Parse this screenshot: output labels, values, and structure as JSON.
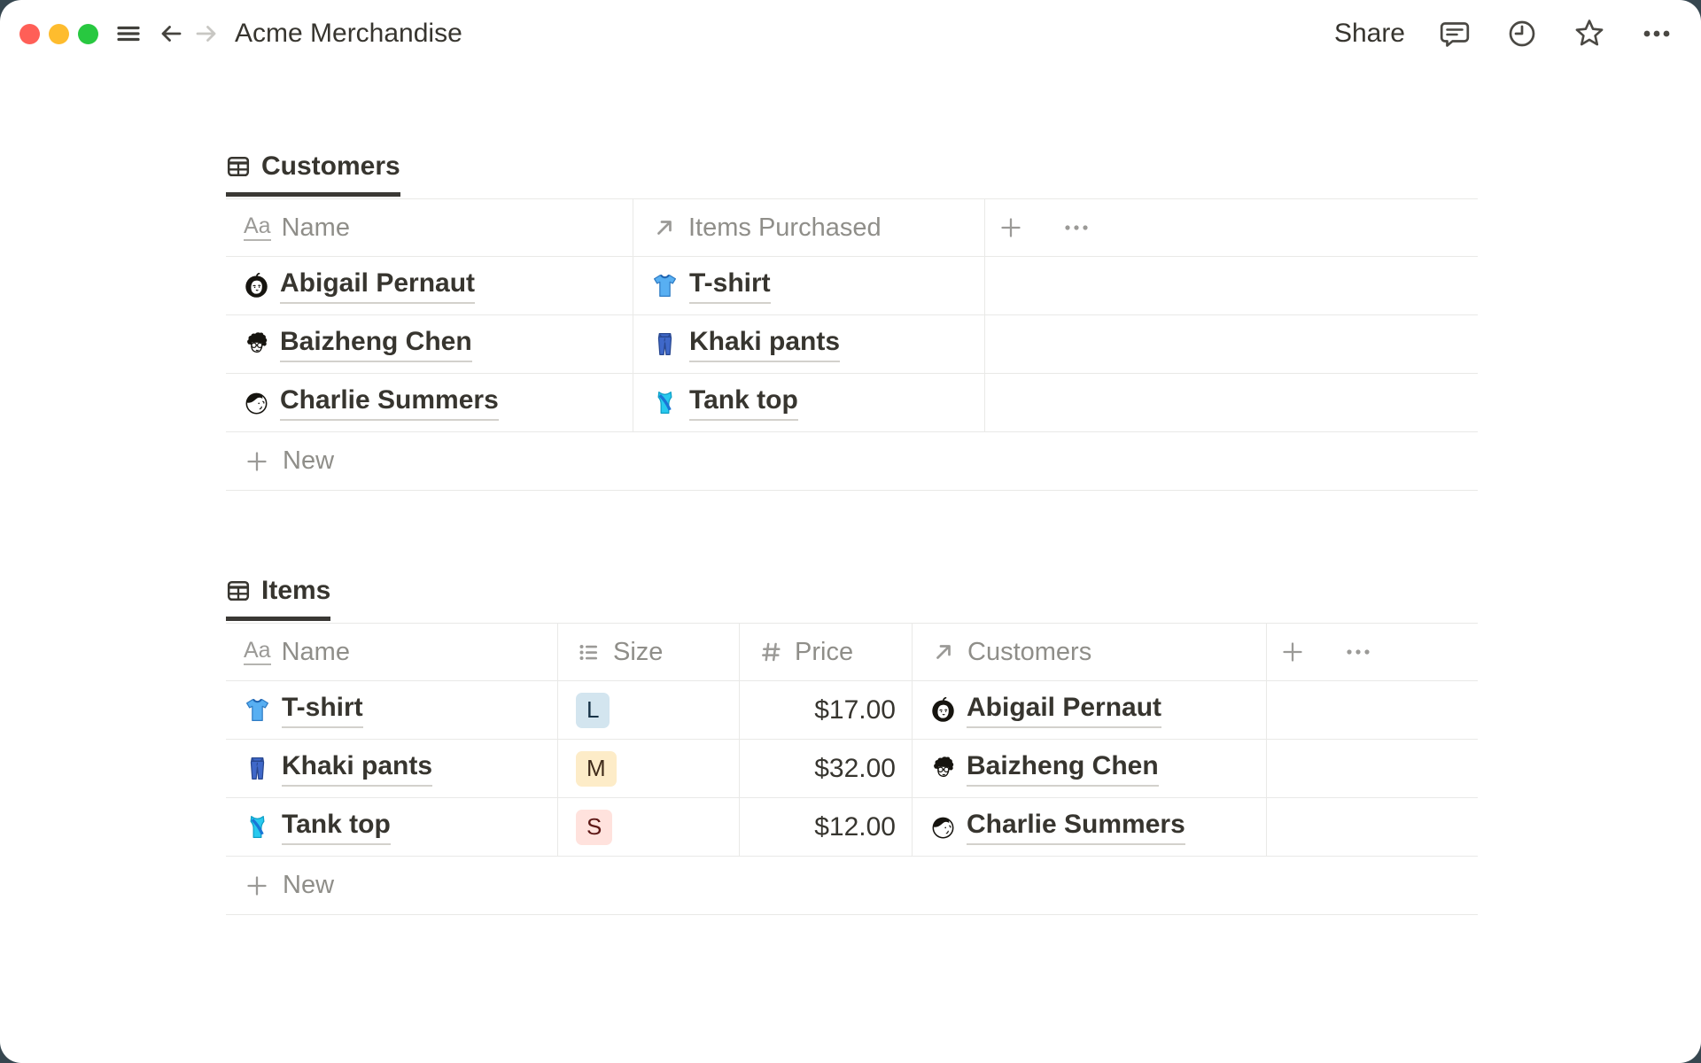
{
  "topbar": {
    "title": "Acme Merchandise",
    "share_label": "Share",
    "nav": {
      "hamburger_icon": "hamburger-icon",
      "back_icon": "back-icon",
      "forward_icon": "forward-icon"
    },
    "action_icons": {
      "comments": "comment-icon",
      "history": "clock-icon",
      "favorite": "star-icon",
      "more": "more-icon"
    },
    "traffic_lights": {
      "close": "#ff5f57",
      "minimize": "#febc2e",
      "zoom": "#28c840"
    }
  },
  "colors": {
    "desktop_bg": "#374750",
    "text": "#37352f",
    "muted": "#8f8e89",
    "border": "#e9e9e7",
    "link_underline": "#d3d1cc",
    "tab_underline": "#3a3834",
    "badges": {
      "blue": {
        "bg": "#d3e5ef",
        "fg": "#183347"
      },
      "yellow": {
        "bg": "#fdecc8",
        "fg": "#402c1b"
      },
      "red": {
        "bg": "#ffe2dd",
        "fg": "#5d1715"
      }
    }
  },
  "customers_table": {
    "tab_label": "Customers",
    "tab_icon": "table-icon",
    "columns": [
      {
        "label": "Name",
        "icon": "text-icon"
      },
      {
        "label": "Items Purchased",
        "icon": "relation-icon"
      }
    ],
    "header_actions": {
      "add_icon": "plus-icon",
      "more_icon": "dots-icon"
    },
    "rows": [
      {
        "name": "Abigail Pernaut",
        "avatar": "avatar-abigail",
        "item": "T-shirt",
        "item_icon": "emoji-tshirt"
      },
      {
        "name": "Baizheng Chen",
        "avatar": "avatar-baizheng",
        "item": "Khaki pants",
        "item_icon": "emoji-jeans"
      },
      {
        "name": "Charlie Summers",
        "avatar": "avatar-charlie",
        "item": "Tank top",
        "item_icon": "emoji-tank"
      }
    ],
    "new_row": {
      "label": "New",
      "icon": "plus-icon"
    }
  },
  "items_table": {
    "tab_label": "Items",
    "tab_icon": "table-icon",
    "columns": [
      {
        "label": "Name",
        "icon": "text-icon"
      },
      {
        "label": "Size",
        "icon": "select-icon"
      },
      {
        "label": "Price",
        "icon": "number-icon"
      },
      {
        "label": "Customers",
        "icon": "relation-icon"
      }
    ],
    "header_actions": {
      "add_icon": "plus-icon",
      "more_icon": "dots-icon"
    },
    "rows": [
      {
        "name": "T-shirt",
        "icon": "emoji-tshirt",
        "size": "L",
        "size_color": "blue",
        "price": "$17.00",
        "customer": "Abigail Pernaut",
        "customer_avatar": "avatar-abigail"
      },
      {
        "name": "Khaki pants",
        "icon": "emoji-jeans",
        "size": "M",
        "size_color": "yellow",
        "price": "$32.00",
        "customer": "Baizheng Chen",
        "customer_avatar": "avatar-baizheng"
      },
      {
        "name": "Tank top",
        "icon": "emoji-tank",
        "size": "S",
        "size_color": "red",
        "price": "$12.00",
        "customer": "Charlie Summers",
        "customer_avatar": "avatar-charlie"
      }
    ],
    "new_row": {
      "label": "New",
      "icon": "plus-icon"
    }
  }
}
